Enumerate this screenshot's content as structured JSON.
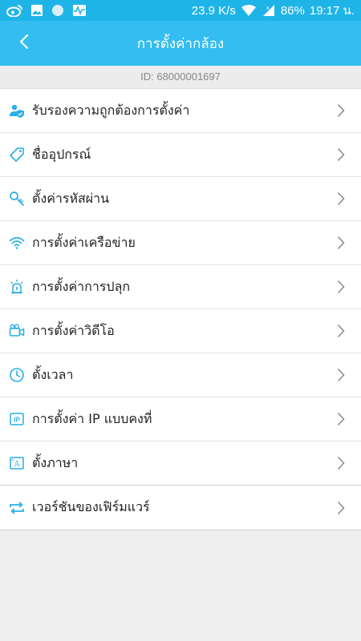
{
  "status_bar": {
    "speed": "23.9 K/s",
    "battery": "86%",
    "time": "19:17 น."
  },
  "header": {
    "title": "การตั้งค่ากล้อง"
  },
  "device": {
    "id_text": "ID:  68000001697"
  },
  "menu": [
    {
      "label": "รับรองความถูกต้องการตั้งค่า",
      "icon": "user-shield-icon"
    },
    {
      "label": "ชื่ออุปกรณ์",
      "icon": "tag-icon"
    },
    {
      "label": "ตั้งค่ารหัสผ่าน",
      "icon": "key-icon"
    },
    {
      "label": "การตั้งค่าเครือข่าย",
      "icon": "wifi-icon"
    },
    {
      "label": "การตั้งค่าการปลุก",
      "icon": "alarm-icon"
    },
    {
      "label": "การตั้งค่าวิดีโอ",
      "icon": "video-camera-icon"
    },
    {
      "label": "ตั้งเวลา",
      "icon": "clock-icon"
    },
    {
      "label": "การตั้งค่า IP แบบคงที่",
      "icon": "ip-icon"
    },
    {
      "label": "ตั้งภาษา",
      "icon": "language-icon"
    },
    {
      "label": "เวอร์ชันของเฟิร์มแวร์",
      "icon": "firmware-update-icon"
    }
  ],
  "colors": {
    "accent": "#33bdf0",
    "status_bar": "#1fb4e8",
    "icon": "#29aee6"
  }
}
